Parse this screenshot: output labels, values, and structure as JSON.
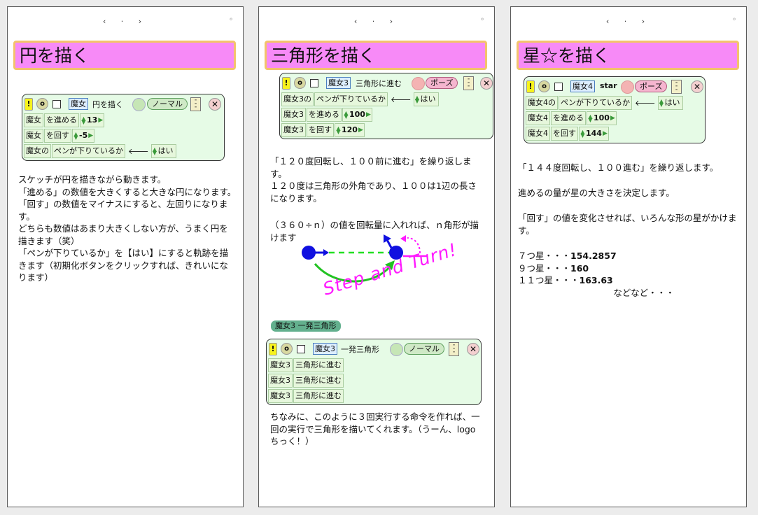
{
  "nav_glyph": "‹ · ›",
  "corner_dot": "◦",
  "page1": {
    "title": "円を描く",
    "script": {
      "header": {
        "object": "魔女",
        "name": "円を描く",
        "mode": "ノーマル"
      },
      "rows": [
        {
          "obj": "魔女",
          "cmd": "を進める",
          "value": "13"
        },
        {
          "obj": "魔女",
          "cmd": "を回す",
          "value": "-5"
        },
        {
          "obj": "魔女の",
          "cmd": "ペンが下りているか",
          "assign": "はい"
        }
      ]
    },
    "body": [
      "スケッチが円を描きながら動きます。",
      "「進める」の数値を大きくすると大きな円になります。",
      "「回す」の数値をマイナスにすると、左回りになります。",
      "どちらも数値はあまり大きくしない方が、うまく円を描きます（笑）",
      "「ペンが下りているか」を【はい】にすると軌跡を描きます（初期化ボタンをクリックすれば、きれいになります）"
    ]
  },
  "page2": {
    "title": "三角形を描く",
    "script": {
      "header": {
        "object": "魔女3",
        "name": "三角形に進む",
        "mode": "ポーズ"
      },
      "rows": [
        {
          "obj": "魔女3の",
          "cmd": "ペンが下りているか",
          "assign": "はい"
        },
        {
          "obj": "魔女3",
          "cmd": "を進める",
          "value": "100"
        },
        {
          "obj": "魔女3",
          "cmd": "を回す",
          "value": "120"
        }
      ]
    },
    "body1": [
      "「１２０度回転し、１００前に進む」を繰り返します。",
      "１２０度は三角形の外角であり、１００は1辺の長さになります。"
    ],
    "body2": "（３６０÷ｎ）の値を回転量に入れれば、ｎ角形が描けます",
    "handwriting": "Step and Turn!",
    "tag_label": "魔女3 一発三角形",
    "script2": {
      "header": {
        "object": "魔女3",
        "name": "一発三角形",
        "mode": "ノーマル"
      },
      "rows": [
        {
          "obj": "魔女3",
          "cmd": "三角形に進む"
        },
        {
          "obj": "魔女3",
          "cmd": "三角形に進む"
        },
        {
          "obj": "魔女3",
          "cmd": "三角形に進む"
        }
      ]
    },
    "body3": [
      "ちなみに、このように３回実行する命令を作れば、一回の実行で三角形を描いてくれます。（うーん、logoちっく！）"
    ]
  },
  "page3": {
    "title": "星☆を描く",
    "script": {
      "header": {
        "object": "魔女4",
        "name": "star",
        "mode": "ポーズ"
      },
      "rows": [
        {
          "obj": "魔女4の",
          "cmd": "ペンが下りているか",
          "assign": "はい"
        },
        {
          "obj": "魔女4",
          "cmd": "を進める",
          "value": "100"
        },
        {
          "obj": "魔女4",
          "cmd": "を回す",
          "value": "144"
        }
      ]
    },
    "body1": "「１４４度回転し、１００進む」を繰り返します。",
    "body2": "進めるの量が星の大きさを決定します。",
    "body3": "「回す」の値を変化させれば、いろんな形の星がかけます。",
    "stars": [
      {
        "label": "７つ星・・・",
        "value": "154.2857"
      },
      {
        "label": "９つ星・・・",
        "value": "160"
      },
      {
        "label": "１１つ星・・・",
        "value": "163.63"
      }
    ],
    "etc": "などなど・・・"
  },
  "colors": {
    "title_bg": "#f78af7",
    "title_border": "#f3c36c",
    "script_bg": "#e6fbe6",
    "pen_blue": "#1010e0",
    "magenta": "#ff19ff",
    "green": "#22c222"
  }
}
